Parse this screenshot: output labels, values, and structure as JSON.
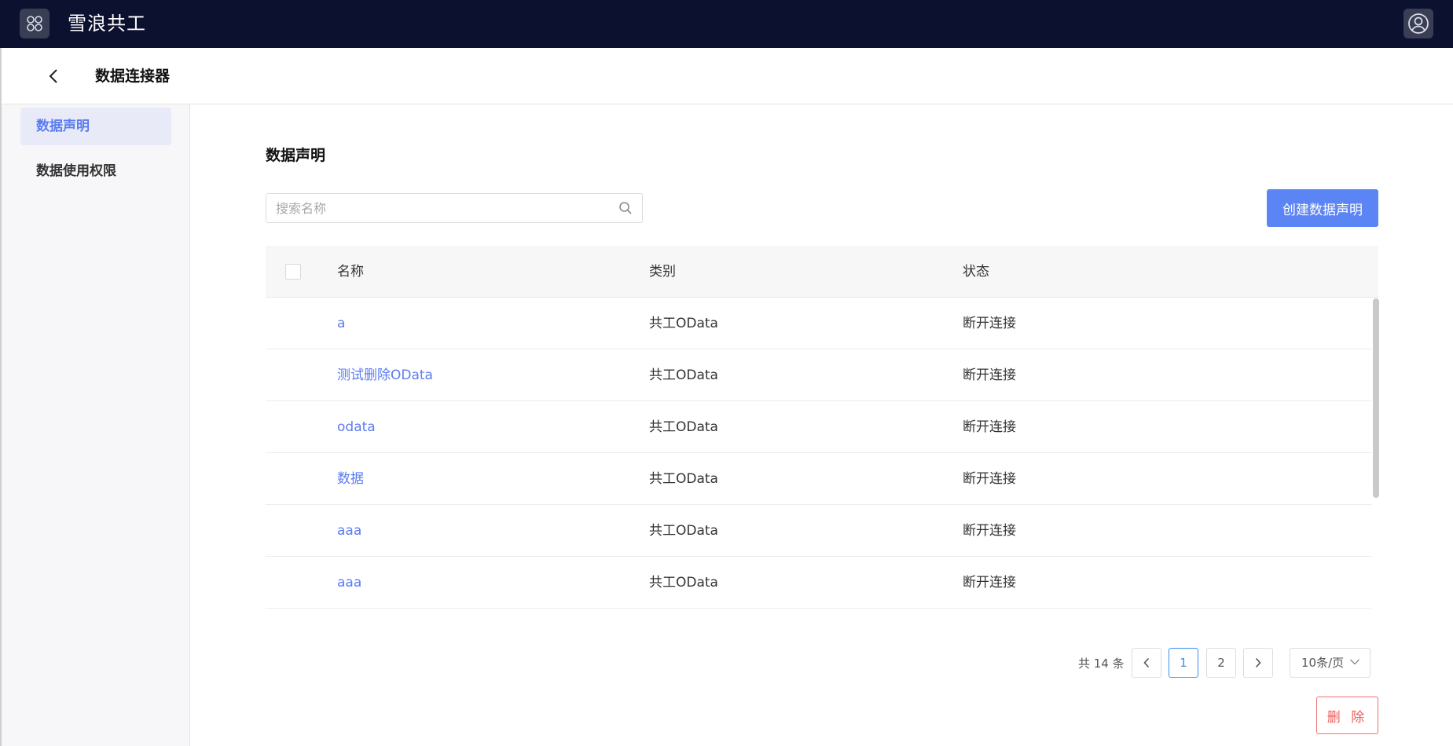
{
  "app": {
    "title": "雪浪共工"
  },
  "header": {
    "title": "数据连接器"
  },
  "sidebar": {
    "items": [
      {
        "label": "数据声明",
        "active": true
      },
      {
        "label": "数据使用权限",
        "active": false
      }
    ]
  },
  "main": {
    "section_title": "数据声明",
    "search": {
      "placeholder": "搜索名称",
      "value": ""
    },
    "create_button": "创建数据声明",
    "table": {
      "columns": [
        "名称",
        "类别",
        "状态"
      ],
      "rows": [
        {
          "name": "a",
          "category": "共工OData",
          "status": "断开连接"
        },
        {
          "name": "测试删除OData",
          "category": "共工OData",
          "status": "断开连接"
        },
        {
          "name": "odata",
          "category": "共工OData",
          "status": "断开连接"
        },
        {
          "name": "数据",
          "category": "共工OData",
          "status": "断开连接"
        },
        {
          "name": "aaa",
          "category": "共工OData",
          "status": "断开连接"
        },
        {
          "name": "aaa",
          "category": "共工OData",
          "status": "断开连接"
        }
      ]
    },
    "pagination": {
      "total_text": "共 14 条",
      "pages": [
        "1",
        "2"
      ],
      "current_page": "1",
      "page_size": "10条/页"
    },
    "delete_button": "删 除"
  },
  "colors": {
    "topbar": "#0c1130",
    "accent": "#5b84f5",
    "link": "#5b7cf0",
    "danger": "#ef5a5a"
  },
  "icons": {
    "launcher": "app-grid-icon",
    "avatar": "user-circle-icon",
    "back": "chevron-left-icon",
    "search": "search-icon",
    "prev": "chevron-left-icon",
    "next": "chevron-right-icon",
    "dropdown": "chevron-down-icon"
  }
}
